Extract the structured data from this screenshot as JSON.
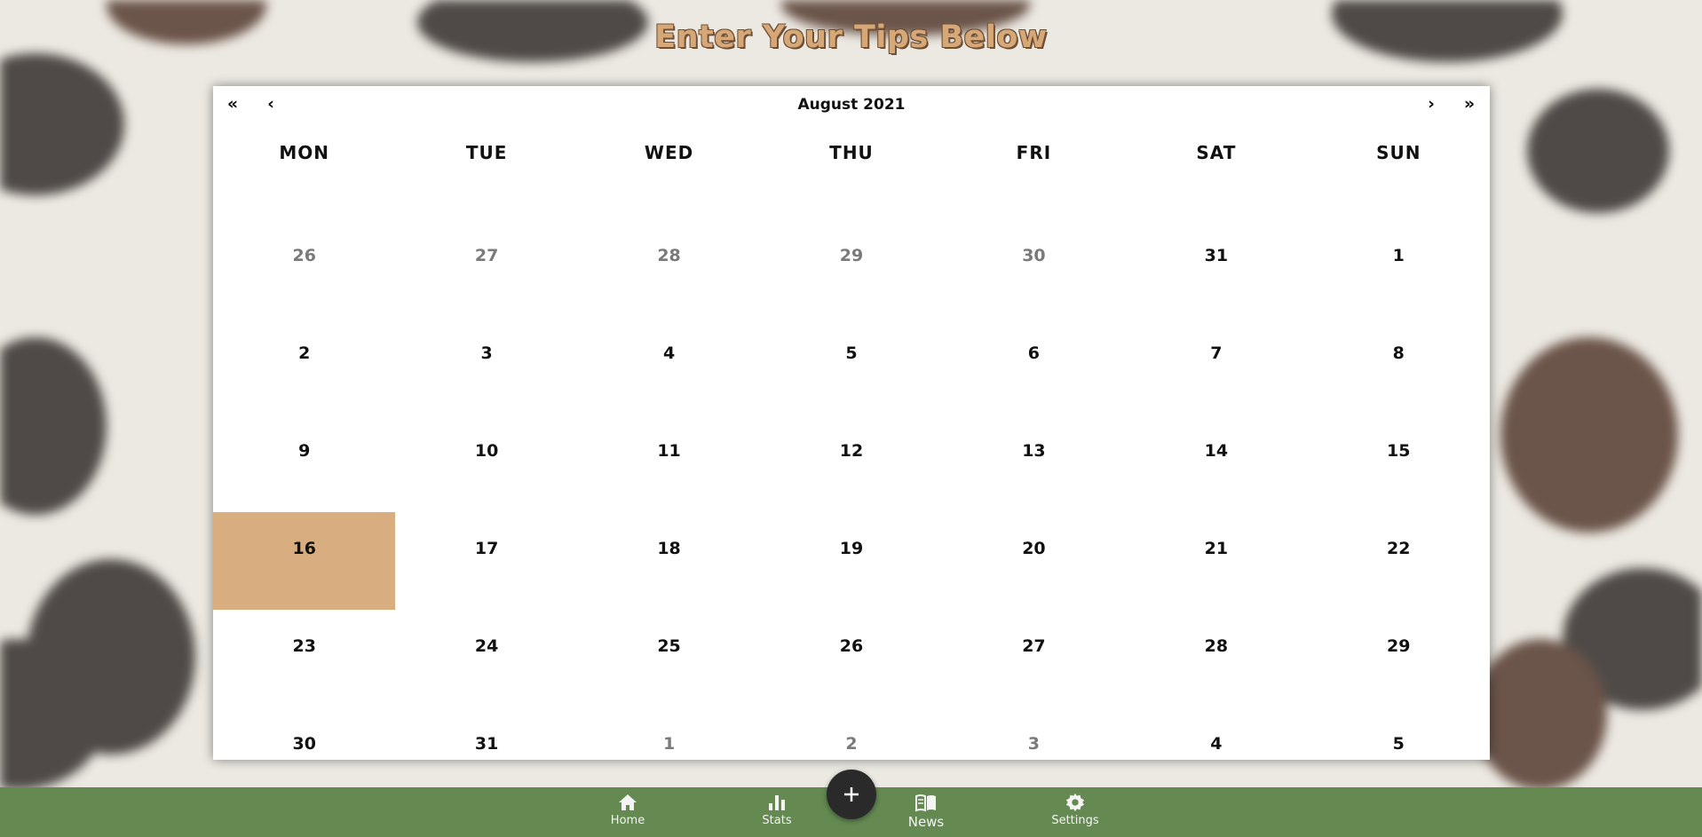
{
  "header": {
    "title": "Enter Your Tips Below"
  },
  "calendar": {
    "nav": {
      "prev_year": "«",
      "prev_month": "‹",
      "next_month": "›",
      "next_year": "»"
    },
    "month_label": "August 2021",
    "weekdays": [
      "MON",
      "TUE",
      "WED",
      "THU",
      "FRI",
      "SAT",
      "SUN"
    ],
    "days": [
      {
        "label": "26",
        "dim": true
      },
      {
        "label": "27",
        "dim": true
      },
      {
        "label": "28",
        "dim": true
      },
      {
        "label": "29",
        "dim": true
      },
      {
        "label": "30",
        "dim": true
      },
      {
        "label": "31",
        "dim": false
      },
      {
        "label": "1",
        "dim": false
      },
      {
        "label": "2",
        "dim": false
      },
      {
        "label": "3",
        "dim": false
      },
      {
        "label": "4",
        "dim": false
      },
      {
        "label": "5",
        "dim": false
      },
      {
        "label": "6",
        "dim": false
      },
      {
        "label": "7",
        "dim": false
      },
      {
        "label": "8",
        "dim": false
      },
      {
        "label": "9",
        "dim": false
      },
      {
        "label": "10",
        "dim": false
      },
      {
        "label": "11",
        "dim": false
      },
      {
        "label": "12",
        "dim": false
      },
      {
        "label": "13",
        "dim": false
      },
      {
        "label": "14",
        "dim": false
      },
      {
        "label": "15",
        "dim": false
      },
      {
        "label": "16",
        "dim": false,
        "selected": true
      },
      {
        "label": "17",
        "dim": false
      },
      {
        "label": "18",
        "dim": false
      },
      {
        "label": "19",
        "dim": false
      },
      {
        "label": "20",
        "dim": false
      },
      {
        "label": "21",
        "dim": false
      },
      {
        "label": "22",
        "dim": false
      },
      {
        "label": "23",
        "dim": false
      },
      {
        "label": "24",
        "dim": false
      },
      {
        "label": "25",
        "dim": false
      },
      {
        "label": "26",
        "dim": false
      },
      {
        "label": "27",
        "dim": false
      },
      {
        "label": "28",
        "dim": false
      },
      {
        "label": "29",
        "dim": false
      },
      {
        "label": "30",
        "dim": false
      },
      {
        "label": "31",
        "dim": false
      },
      {
        "label": "1",
        "dim": true
      },
      {
        "label": "2",
        "dim": true
      },
      {
        "label": "3",
        "dim": true
      },
      {
        "label": "4",
        "dim": false
      },
      {
        "label": "5",
        "dim": false
      }
    ]
  },
  "bottom_nav": {
    "items": [
      {
        "label": "Home",
        "icon": "home-icon"
      },
      {
        "label": "Stats",
        "icon": "bar-chart-icon"
      },
      {
        "label": "News",
        "icon": "newspaper-icon",
        "active": true
      },
      {
        "label": "Settings",
        "icon": "gear-icon"
      }
    ],
    "fab": {
      "icon": "plus-icon",
      "symbol": "+"
    }
  },
  "colors": {
    "accent": "#d8ae80",
    "nav_bar": "#648a52",
    "fab": "#2a2a2a",
    "title": "#d6a877"
  }
}
